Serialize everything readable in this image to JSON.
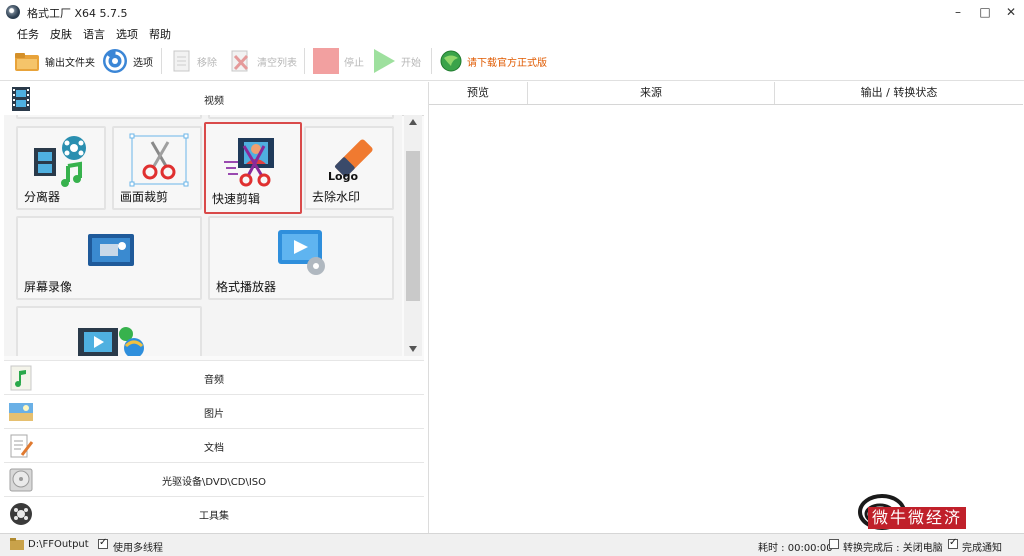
{
  "window": {
    "title": "格式工厂 X64 5.7.5",
    "minimize": "–",
    "maximize": "□",
    "close": "✕"
  },
  "menu": [
    "任务",
    "皮肤",
    "语言",
    "选项",
    "帮助"
  ],
  "toolbar": {
    "output_folder": "输出文件夹",
    "options": "选项",
    "remove": "移除",
    "clear_list": "清空列表",
    "stop": "停止",
    "start": "开始",
    "download": "请下载官方正式版"
  },
  "categories": {
    "video": "视频",
    "audio": "音频",
    "image": "图片",
    "document": "文档",
    "disc": "光驱设备\\DVD\\CD\\ISO",
    "utilities": "工具集"
  },
  "tiles": {
    "splitter": "分离器",
    "crop": "画面裁剪",
    "quick_clip": "快速剪辑",
    "remove_watermark": "去除水印",
    "logo_text": "Logo",
    "screen_record": "屏幕录像",
    "player": "格式播放器"
  },
  "table": {
    "columns": [
      "预览",
      "来源",
      "输出 / 转换状态"
    ]
  },
  "status": {
    "output_path": "D:\\FFOutput",
    "multithread": "使用多线程",
    "elapsed": "耗时 : 00:00:00",
    "shutdown": "转换完成后 : 关闭电脑",
    "notify": "完成通知"
  },
  "watermark": {
    "text": "微牛微经济"
  },
  "colors": {
    "selected_border": "#d94a4a",
    "download_text": "#e05a00",
    "disabled_text": "#b7b7b7"
  }
}
